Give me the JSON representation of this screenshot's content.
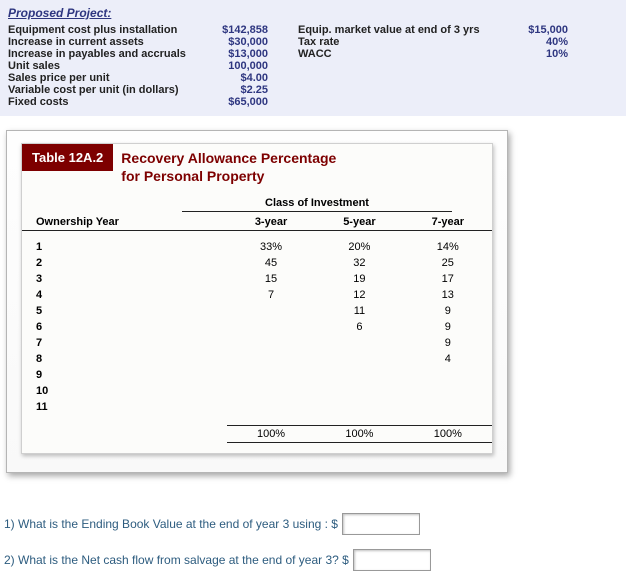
{
  "project": {
    "title": "Proposed Project:",
    "left": [
      {
        "label": "Equipment cost plus installation",
        "value": "$142,858"
      },
      {
        "label": "Increase in current assets",
        "value": "$30,000"
      },
      {
        "label": "Increase in payables and accruals",
        "value": "$13,000"
      },
      {
        "label": "Unit sales",
        "value": "100,000"
      },
      {
        "label": "Sales price per unit",
        "value": "$4.00"
      },
      {
        "label": "Variable cost per unit (in dollars)",
        "value": "$2.25"
      },
      {
        "label": "Fixed costs",
        "value": "$65,000"
      }
    ],
    "right": [
      {
        "label": "Equip. market value at end of 3 yrs",
        "value": "$15,000"
      },
      {
        "label": "Tax rate",
        "value": "40%"
      },
      {
        "label": "WACC",
        "value": "10%"
      }
    ]
  },
  "table": {
    "badge": "Table 12A.2",
    "title_l1": "Recovery Allowance Percentage",
    "title_l2": "for Personal Property",
    "class_label": "Class of Investment",
    "col_ownership": "Ownership Year",
    "cols": [
      "3-year",
      "5-year",
      "7-year"
    ],
    "rows": [
      {
        "y": "1",
        "c": [
          "33%",
          "20%",
          "14%"
        ]
      },
      {
        "y": "2",
        "c": [
          "45",
          "32",
          "25"
        ]
      },
      {
        "y": "3",
        "c": [
          "15",
          "19",
          "17"
        ]
      },
      {
        "y": "4",
        "c": [
          "7",
          "12",
          "13"
        ]
      },
      {
        "y": "5",
        "c": [
          "",
          "11",
          "9"
        ]
      },
      {
        "y": "6",
        "c": [
          "",
          "6",
          "9"
        ]
      },
      {
        "y": "7",
        "c": [
          "",
          "",
          "9"
        ]
      },
      {
        "y": "8",
        "c": [
          "",
          "",
          "4"
        ]
      },
      {
        "y": "9",
        "c": [
          "",
          "",
          ""
        ]
      },
      {
        "y": "10",
        "c": [
          "",
          "",
          ""
        ]
      },
      {
        "y": "11",
        "c": [
          "",
          "",
          ""
        ]
      }
    ],
    "totals": [
      "100%",
      "100%",
      "100%"
    ]
  },
  "questions": {
    "q1": "1) What is the Ending Book Value at the end of year 3 using : $",
    "q2": "2) What is the Net cash flow from salvage at the end of year 3? $"
  }
}
